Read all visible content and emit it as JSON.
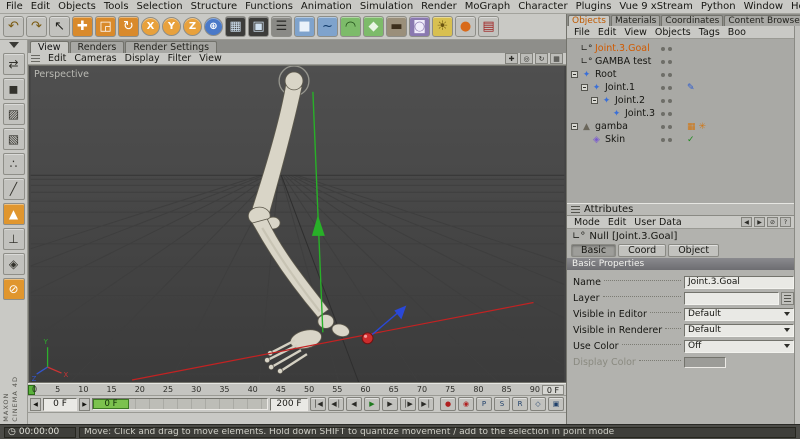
{
  "menubar": {
    "items": [
      "File",
      "Edit",
      "Objects",
      "Tools",
      "Selection",
      "Structure",
      "Functions",
      "Animation",
      "Simulation",
      "Render",
      "MoGraph",
      "Character",
      "Plugins",
      "Vue 9 xStream",
      "Python",
      "Window",
      "Help"
    ]
  },
  "toolbar": {
    "icons": [
      {
        "name": "undo-icon",
        "glyph": "↶",
        "bg": "#c2c2be",
        "fg": "#7a5a10"
      },
      {
        "name": "redo-icon",
        "glyph": "↷",
        "bg": "#c2c2be",
        "fg": "#7a5a10"
      },
      {
        "name": "select-tool-icon",
        "glyph": "↖",
        "bg": "#c2c2be",
        "fg": "#22221e"
      },
      {
        "name": "move-tool-icon",
        "glyph": "✚",
        "bg": "#d98a2b",
        "fg": "#ffffff"
      },
      {
        "name": "scale-tool-icon",
        "glyph": "◲",
        "bg": "#d98a2b",
        "fg": "#ffffff"
      },
      {
        "name": "rotate-tool-icon",
        "glyph": "↻",
        "bg": "#d98a2b",
        "fg": "#ffffff"
      },
      {
        "name": "x-axis-button",
        "glyph": "X",
        "bg": "#e8a13c",
        "fg": "#ffffff",
        "round": true
      },
      {
        "name": "y-axis-button",
        "glyph": "Y",
        "bg": "#e8a13c",
        "fg": "#ffffff",
        "round": true
      },
      {
        "name": "z-axis-button",
        "glyph": "Z",
        "bg": "#e8a13c",
        "fg": "#ffffff",
        "round": true
      },
      {
        "name": "coordinate-system-icon",
        "glyph": "⊕",
        "bg": "#4a79c8",
        "fg": "#ffffff",
        "round": true
      },
      {
        "name": "render-view-icon",
        "glyph": "▦",
        "bg": "#3c3c3a",
        "fg": "#cfe0f0"
      },
      {
        "name": "render-picture-viewer-icon",
        "glyph": "▣",
        "bg": "#3c3c3a",
        "fg": "#cfe0f0"
      },
      {
        "name": "render-settings-icon",
        "glyph": "☰",
        "bg": "#8a8a86",
        "fg": "#2a2a28"
      },
      {
        "name": "add-cube-icon",
        "glyph": "■",
        "bg": "#7fa3cc",
        "fg": "#eaf2fa"
      },
      {
        "name": "spline-pen-icon",
        "glyph": "~",
        "bg": "#7fa3cc",
        "fg": "#103a6a"
      },
      {
        "name": "nurbs-icon",
        "glyph": "◠",
        "bg": "#7dbb6a",
        "fg": "#1c4a14"
      },
      {
        "name": "modifier-icon",
        "glyph": "◆",
        "bg": "#7dbb6a",
        "fg": "#eaf6e6"
      },
      {
        "name": "floor-object-icon",
        "glyph": "▬",
        "bg": "#9a8f7a",
        "fg": "#3c2f1c"
      },
      {
        "name": "camera-icon",
        "glyph": "◙",
        "bg": "#8a79b0",
        "fg": "#f0ecfa"
      },
      {
        "name": "light-icon",
        "glyph": "☀",
        "bg": "#d8c050",
        "fg": "#6a5410"
      },
      {
        "name": "sphere-preset-icon",
        "glyph": "●",
        "bg": "#c2c2be",
        "fg": "#d86a1a"
      },
      {
        "name": "library-icon",
        "glyph": "▤",
        "bg": "#c2c2be",
        "fg": "#a02020"
      }
    ]
  },
  "left_toolbar": {
    "icons": [
      {
        "name": "make-editable-icon",
        "glyph": "⇄"
      },
      {
        "name": "model-mode-icon",
        "glyph": "◼"
      },
      {
        "name": "texture-mode-icon",
        "glyph": "▨"
      },
      {
        "name": "texture-axis-icon",
        "glyph": "▧"
      },
      {
        "name": "point-mode-icon",
        "glyph": "∴"
      },
      {
        "name": "edge-mode-icon",
        "glyph": "╱"
      },
      {
        "name": "polygon-mode-icon",
        "glyph": "▲",
        "active": true
      },
      {
        "name": "object-axis-icon",
        "glyph": "⊥"
      },
      {
        "name": "snap-icon",
        "glyph": "◈"
      },
      {
        "name": "lock-workplane-icon",
        "glyph": "⊘",
        "active": true
      }
    ]
  },
  "view_tabs": [
    {
      "label": "View",
      "active": true
    },
    {
      "label": "Renders"
    },
    {
      "label": "Render Settings"
    }
  ],
  "viewport": {
    "label": "Perspective",
    "menu": [
      "Edit",
      "Cameras",
      "Display",
      "Filter",
      "View"
    ],
    "nav": [
      {
        "name": "pan-view-icon",
        "glyph": "✚"
      },
      {
        "name": "zoom-view-icon",
        "glyph": "◎"
      },
      {
        "name": "rotate-view-icon",
        "glyph": "↻"
      },
      {
        "name": "toggle-views-icon",
        "glyph": "▦"
      }
    ],
    "watermark_1": "MAXON",
    "watermark_2": "CINEMA 4D",
    "axis": {
      "x": "X",
      "y": "Y",
      "z": "Z"
    }
  },
  "object_manager": {
    "tabs": [
      {
        "label": "Objects",
        "active": true
      },
      {
        "label": "Materials"
      },
      {
        "label": "Coordinates"
      },
      {
        "label": "Content Browser"
      }
    ],
    "menu": [
      "File",
      "Edit",
      "View",
      "Objects",
      "Tags",
      "Boo"
    ],
    "tree": [
      {
        "label": "Joint.3.Goal",
        "icon": "null-icon",
        "glyph": "∟°",
        "selected": true
      },
      {
        "label": "GAMBA test",
        "icon": "null-icon",
        "glyph": "∟°"
      },
      {
        "label": "Root",
        "icon": "joint-icon",
        "glyph": "✦"
      },
      {
        "label": "Joint.1",
        "icon": "joint-icon",
        "glyph": "✦",
        "tags": [
          {
            "name": "ik-tag-icon",
            "glyph": "✎"
          }
        ]
      },
      {
        "label": "Joint.2",
        "icon": "joint-icon",
        "glyph": "✦"
      },
      {
        "label": "Joint.3",
        "icon": "joint-icon",
        "glyph": "✦"
      },
      {
        "label": "gamba",
        "icon": "mesh-icon",
        "glyph": "▲",
        "tags": [
          {
            "name": "weights-tag-icon",
            "glyph": "▦"
          },
          {
            "name": "texture-tag-icon",
            "glyph": "✳"
          }
        ]
      },
      {
        "label": "Skin",
        "icon": "skin-icon",
        "glyph": "◈",
        "tags": [
          {
            "name": "check-tag-icon",
            "glyph": "✓"
          }
        ]
      }
    ]
  },
  "attributes": {
    "title": "Attributes",
    "menu": [
      "Mode",
      "Edit",
      "User Data"
    ],
    "nav": [
      {
        "name": "history-back-icon",
        "glyph": "◀"
      },
      {
        "name": "history-forward-icon",
        "glyph": "▶"
      },
      {
        "name": "lock-icon",
        "glyph": "⊘"
      },
      {
        "name": "help-icon",
        "glyph": "?"
      }
    ],
    "object_glyph": "∟°",
    "object_label": "Null [Joint.3.Goal]",
    "tabs": [
      {
        "label": "Basic",
        "active": true
      },
      {
        "label": "Coord"
      },
      {
        "label": "Object"
      }
    ],
    "section": "Basic Properties",
    "fields": {
      "name": {
        "label": "Name",
        "value": "Joint.3.Goal"
      },
      "layer": {
        "label": "Layer",
        "value": ""
      },
      "visible_editor": {
        "label": "Visible in Editor",
        "value": "Default"
      },
      "visible_renderer": {
        "label": "Visible in Renderer",
        "value": "Default"
      },
      "use_color": {
        "label": "Use Color",
        "value": "Off"
      },
      "display_color": {
        "label": "Display Color"
      }
    }
  },
  "timeline": {
    "ticks": [
      "0",
      "5",
      "10",
      "15",
      "20",
      "25",
      "30",
      "35",
      "40",
      "45",
      "50",
      "55",
      "60",
      "65",
      "70",
      "75",
      "80",
      "85",
      "90"
    ],
    "ruler_end": "0 F",
    "spin_left": "◀",
    "spin_right": "▶",
    "frame_value": "0 F",
    "slider_handle": "0 F",
    "range_end": "200 F",
    "transport": [
      {
        "name": "goto-start-button",
        "glyph": "│◀"
      },
      {
        "name": "prev-key-button",
        "glyph": "◀│"
      },
      {
        "name": "prev-frame-button",
        "glyph": "◀"
      },
      {
        "name": "play-button",
        "glyph": "▶",
        "fg": "#1e7a1e"
      },
      {
        "name": "next-frame-button",
        "glyph": "▶"
      },
      {
        "name": "next-key-button",
        "glyph": "│▶"
      },
      {
        "name": "goto-end-button",
        "glyph": "▶│"
      }
    ],
    "record": [
      {
        "name": "record-keyframe-button",
        "glyph": "●",
        "fg": "#b02020"
      },
      {
        "name": "autokey-button",
        "glyph": "◉",
        "fg": "#b02020"
      },
      {
        "name": "record-position-toggle",
        "glyph": "P",
        "fg": "#20406a"
      },
      {
        "name": "record-scale-toggle",
        "glyph": "S",
        "fg": "#20406a"
      },
      {
        "name": "record-rotation-toggle",
        "glyph": "R",
        "fg": "#20406a"
      },
      {
        "name": "record-parameter-toggle",
        "glyph": "◇",
        "fg": "#20406a"
      },
      {
        "name": "record-pla-toggle",
        "glyph": "▣",
        "fg": "#20406a"
      }
    ]
  },
  "statusbar": {
    "clock": "◷",
    "time": "00:00:00",
    "message": "Move: Click and drag to move elements. Hold down SHIFT to quantize movement / add to the selection in point mode"
  }
}
